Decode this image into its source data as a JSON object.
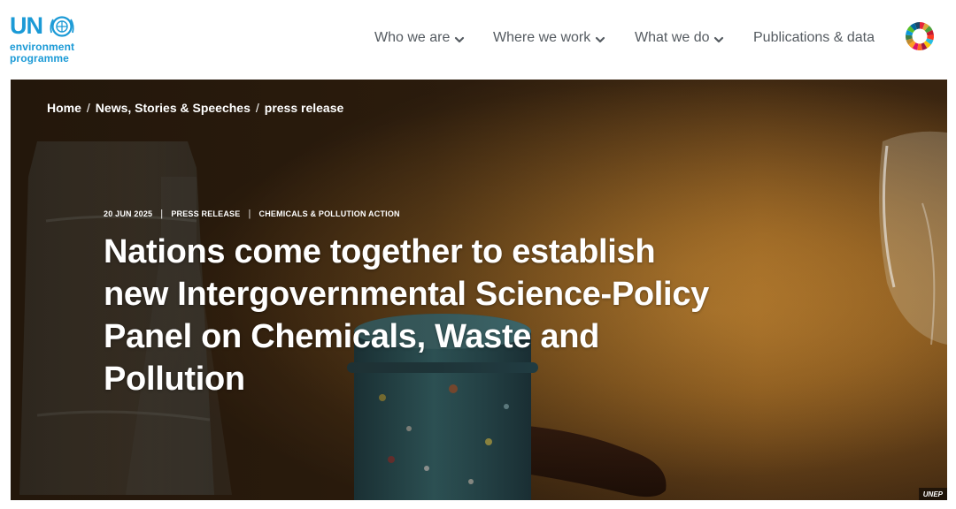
{
  "logo": {
    "un": "UN",
    "line1": "environment",
    "line2": "programme",
    "emblem_icon": "un-emblem-icon",
    "color": "#1b9ad6"
  },
  "nav": {
    "items": [
      {
        "label": "Who we are",
        "has_dropdown": true
      },
      {
        "label": "Where we work",
        "has_dropdown": true
      },
      {
        "label": "What we do",
        "has_dropdown": true
      },
      {
        "label": "Publications & data",
        "has_dropdown": false
      }
    ],
    "sdg_icon": "sdg-color-wheel-icon",
    "text_color": "#555b61"
  },
  "breadcrumb": {
    "items": [
      "Home",
      "News, Stories & Speeches",
      "press release"
    ],
    "separator": "/"
  },
  "article": {
    "date": "20 JUN 2025",
    "type": "PRESS RELEASE",
    "topic": "CHEMICALS & POLLUTION ACTION",
    "title": "Nations come together to establish new Intergovernmental Science-Policy Panel on Chemicals, Waste and Pollution"
  },
  "hero": {
    "image_credit": "UNEP",
    "image_subject": "gavel"
  }
}
